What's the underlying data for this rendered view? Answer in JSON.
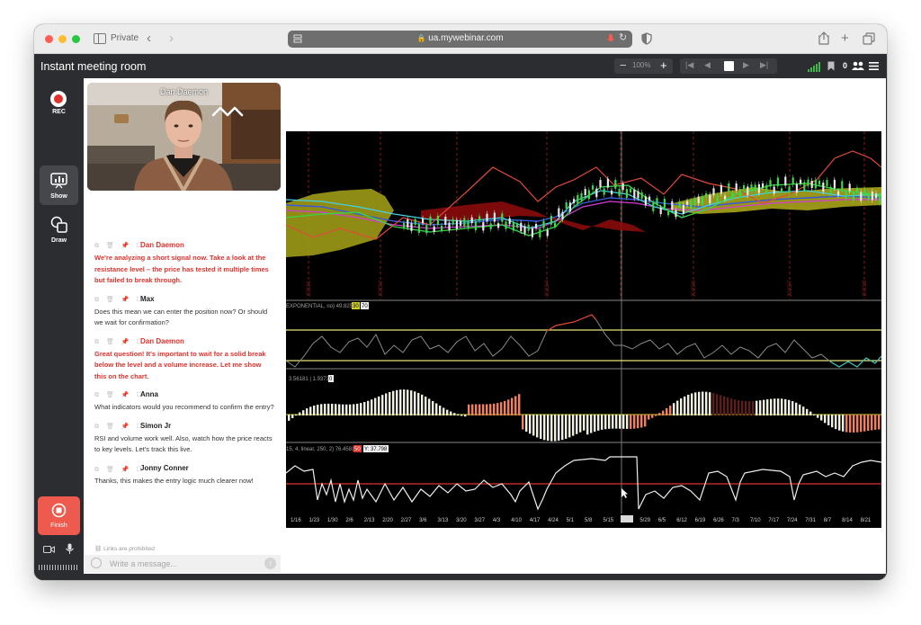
{
  "browser": {
    "private_label": "Private",
    "url": "ua.mywebinar.com"
  },
  "app": {
    "title": "Instant meeting room",
    "zoom": "100%",
    "participants_count": "0"
  },
  "toolbar": {
    "rec_label": "REC",
    "show_label": "Show",
    "draw_label": "Draw",
    "finish_label": "Finish"
  },
  "video": {
    "speaker_name": "Dan Daemon"
  },
  "chat": {
    "messages": [
      {
        "author": "Dan Daemon",
        "host": true,
        "text": "We're analyzing a short signal now. Take a look at the resistance level – the price has tested it multiple times but failed to break through."
      },
      {
        "author": "Max",
        "host": false,
        "text": "Does this mean we can enter the position now? Or should we wait for confirmation?"
      },
      {
        "author": "Dan Daemon",
        "host": true,
        "text": "Great question! It's important to wait for a solid break below the level and a volume increase. Let me show this on the chart."
      },
      {
        "author": "Anna",
        "host": false,
        "text": "What indicators would you recommend to confirm the entry?"
      },
      {
        "author": "Simon Jr",
        "host": false,
        "text": "RSI and volume work well. Also, watch how the price reacts to key levels. Let's track this live."
      },
      {
        "author": "Jonny Conner",
        "host": false,
        "text": "Thanks, this makes the entry logic much clearer now!"
      }
    ],
    "links_note": "Links are prohibited",
    "input_placeholder": "Write a message..."
  },
  "chart": {
    "panel2_label": "EXPONENTIAL, no) 49.8252",
    "panel2_v1": "30",
    "panel2_v2": "70",
    "panel3_label": "3.56181 | 1.93730",
    "panel3_v": "0",
    "panel4_label": "15, 4, linear, 250, 2) 76.4581",
    "panel4_v1": "50",
    "panel4_v2": "Y: 37.798",
    "x_ticks": [
      "1/16",
      "1/23",
      "1/30",
      "2/6",
      "2/13",
      "2/20",
      "2/27",
      "3/6",
      "3/13",
      "3/20",
      "3/27",
      "4/3",
      "4/10",
      "4/17",
      "4/24",
      "5/1",
      "5/8",
      "5/15",
      "",
      "5/29",
      "6/5",
      "6/12",
      "6/19",
      "6/26",
      "7/3",
      "7/10",
      "7/17",
      "7/24",
      "7/31",
      "8/7",
      "8/14",
      "8/21"
    ]
  },
  "colors": {
    "host_red": "#e0312c",
    "finish_red": "#ee5a4e",
    "signal_green": "#3fb64a"
  }
}
